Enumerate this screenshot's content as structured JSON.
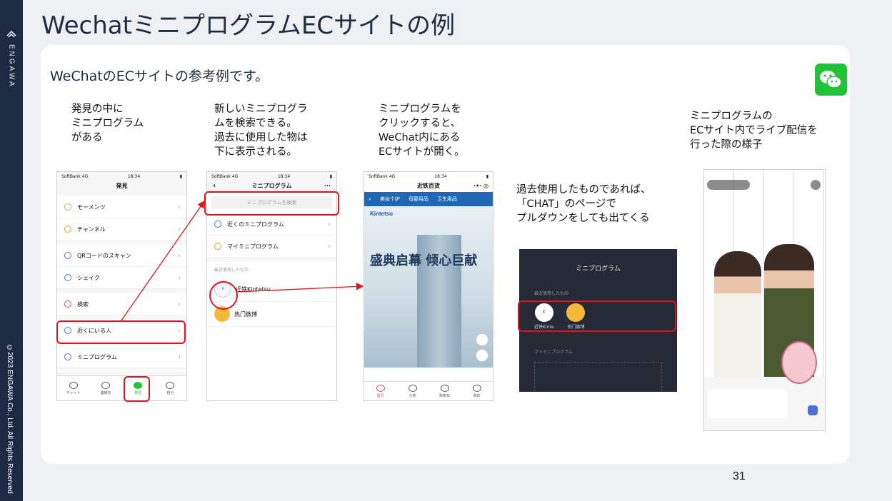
{
  "slide": {
    "title": "WechatミニプログラムECサイトの例",
    "subtitle": "WeChatのECサイトの参考例です。",
    "page_number": "31"
  },
  "sidebar": {
    "brand": "ENGAWA",
    "copyright": "©2023 ENGAWA Co., Ltd. All Rights Reserved"
  },
  "captions": {
    "c1": "発見の中に\nミニプログラム\nがある",
    "c2": "新しいミニプログラ\nムを検索できる。\n過去に使用した物は\n下に表示される。",
    "c3": "ミニプログラムを\nクリックすると、\nWeChat内にある\nECサイトが開く。",
    "c4": "過去使用したものであれば、\n「CHAT」のページで\nプルダウンをしても出てくる",
    "c5": "ミニプログラムの\nECサイト内でライブ配信を\n行った際の様子"
  },
  "phone1": {
    "carrier": "SoftBank 4G",
    "time": "18:34",
    "title": "発見",
    "items": [
      "モーメンツ",
      "チャンネル",
      "QRコードのスキャン",
      "シェイク",
      "検索",
      "近くにいる人",
      "ミニプログラム"
    ],
    "tabs": [
      "チャット",
      "連絡先",
      "発見",
      "自分"
    ]
  },
  "phone2": {
    "carrier": "SoftBank 4G",
    "time": "18:34",
    "title": "ミニプログラム",
    "search_placeholder": "ミニプログラムを検索",
    "items": [
      "近くのミニプログラム",
      "マイミニプログラム"
    ],
    "recent_label": "最近使用したもの",
    "recent": [
      "近铁Kintetsu",
      "热门微博"
    ]
  },
  "phone3": {
    "carrier": "SoftBank 4G",
    "time": "18:34",
    "title": "近铁百货",
    "categories": [
      "美妆个护",
      "母婴用品",
      "卫生用品"
    ],
    "brand": "Kintetsu",
    "banner": "盛典启幕 倾心巨献",
    "nav_tabs": [
      "首页",
      "分类",
      "购物车",
      "我的"
    ]
  },
  "phone4": {
    "title": "ミニプログラム",
    "recent_label": "最近使用したもの",
    "apps": [
      "近铁Kinte",
      "热门微博"
    ],
    "my_label": "マイミニプログラム"
  },
  "colors": {
    "accent_red": "#e0121c",
    "navy": "#1d2b42",
    "wechat_green": "#1ec436"
  }
}
